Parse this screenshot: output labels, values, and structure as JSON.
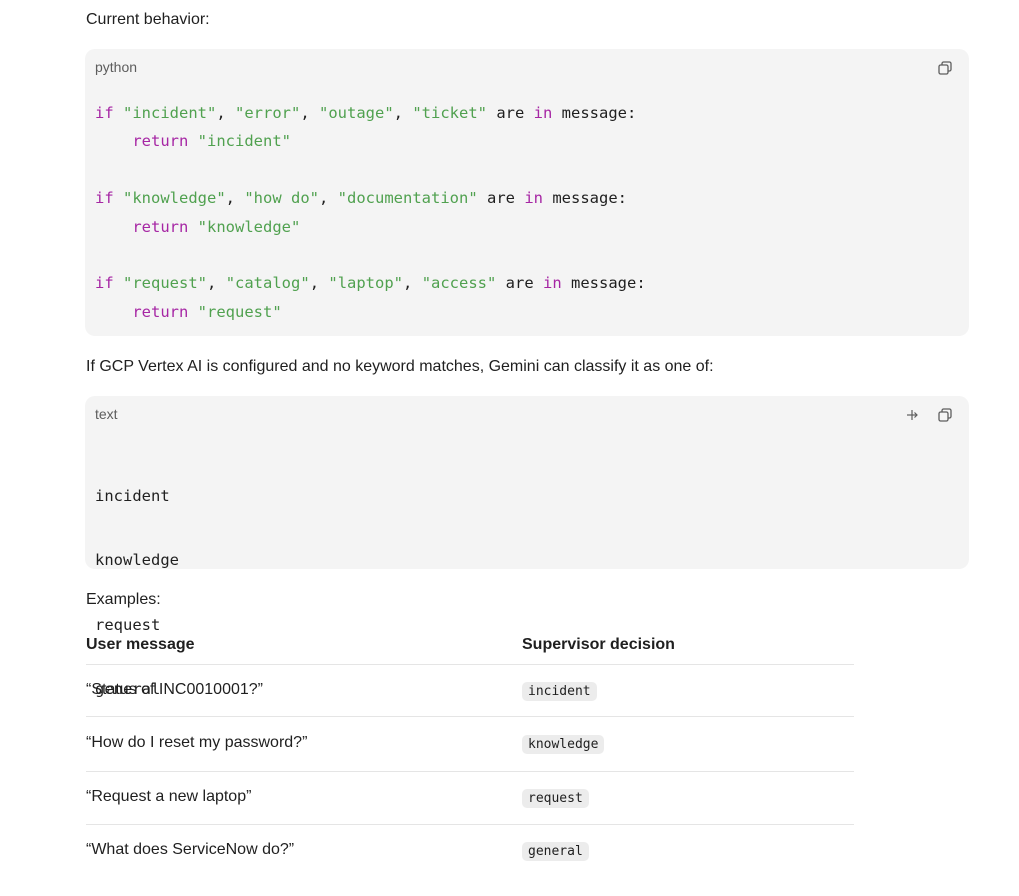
{
  "intro": {
    "current_behavior": "Current behavior:",
    "vertex_text": "If GCP Vertex AI is configured and no keyword matches, Gemini can classify it as one of:",
    "examples": "Examples:"
  },
  "code_python": {
    "lang": "python",
    "lines": [
      [
        "if ",
        "\"incident\"",
        ", ",
        "\"error\"",
        ", ",
        "\"outage\"",
        ", ",
        "\"ticket\"",
        " are ",
        "in",
        " message:"
      ],
      [
        "    ",
        "return",
        " ",
        "\"incident\""
      ],
      [],
      [
        "if ",
        "\"knowledge\"",
        ", ",
        "\"how do\"",
        ", ",
        "\"documentation\"",
        " are ",
        "in",
        " message:"
      ],
      [
        "    ",
        "return",
        " ",
        "\"knowledge\""
      ],
      [],
      [
        "if ",
        "\"request\"",
        ", ",
        "\"catalog\"",
        ", ",
        "\"laptop\"",
        ", ",
        "\"access\"",
        " are ",
        "in",
        " message:"
      ],
      [
        "    ",
        "return",
        " ",
        "\"request\""
      ]
    ]
  },
  "code_text": {
    "lang": "text",
    "lines": [
      "incident",
      "knowledge",
      "request",
      "general"
    ]
  },
  "table": {
    "headers": [
      "User message",
      "Supervisor decision"
    ],
    "rows": [
      {
        "message": "“Status of INC0010001?”",
        "decision": "incident"
      },
      {
        "message": "“How do I reset my password?”",
        "decision": "knowledge"
      },
      {
        "message": "“Request a new laptop”",
        "decision": "request"
      },
      {
        "message": "“What does ServiceNow do?”",
        "decision": "general"
      }
    ]
  },
  "icons": {
    "copy": "copy-icon",
    "wrap": "wrap-icon"
  },
  "colors": {
    "keyword": "#a626a4",
    "string": "#50a14f",
    "code_bg": "#f4f4f4"
  }
}
